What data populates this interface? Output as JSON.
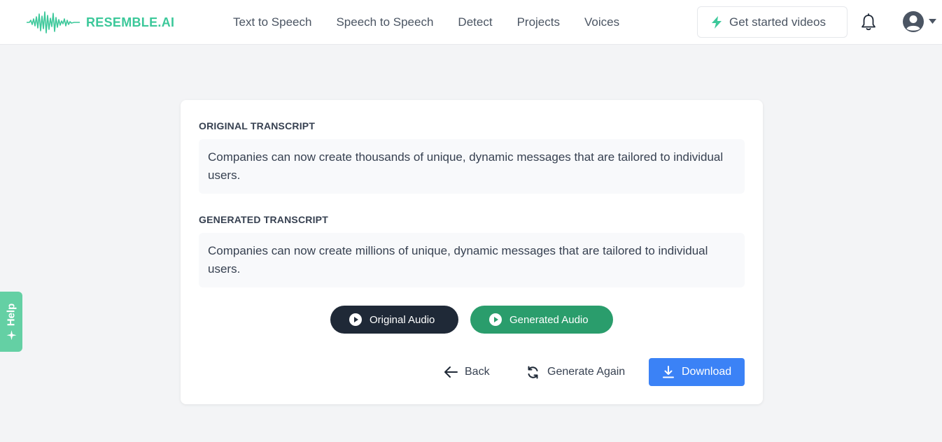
{
  "brand": {
    "name": "RESEMBLE.AI",
    "color": "#3cc89a"
  },
  "nav": {
    "items": [
      "Text to Speech",
      "Speech to Speech",
      "Detect",
      "Projects",
      "Voices"
    ]
  },
  "header": {
    "videos_button": "Get started videos",
    "icons": [
      "bolt-icon",
      "bell-icon",
      "user-avatar-icon",
      "caret-down-icon"
    ]
  },
  "help_tab": {
    "label": "Help",
    "color": "#64d0a4"
  },
  "card": {
    "original": {
      "title": "ORIGINAL TRANSCRIPT",
      "text": "Companies can now create thousands of unique, dynamic messages that are tailored to individual users."
    },
    "generated": {
      "title": "GENERATED TRANSCRIPT",
      "text": "Companies can now create millions of unique, dynamic messages that are tailored to individual users."
    },
    "audio": {
      "original_label": "Original Audio",
      "generated_label": "Generated Audio"
    },
    "actions": {
      "back_label": "Back",
      "regenerate_label": "Generate Again",
      "download_label": "Download"
    }
  },
  "colors": {
    "accent_green": "#2a9d6c",
    "dark_button": "#1f2937",
    "download_blue": "#3b82f6"
  }
}
